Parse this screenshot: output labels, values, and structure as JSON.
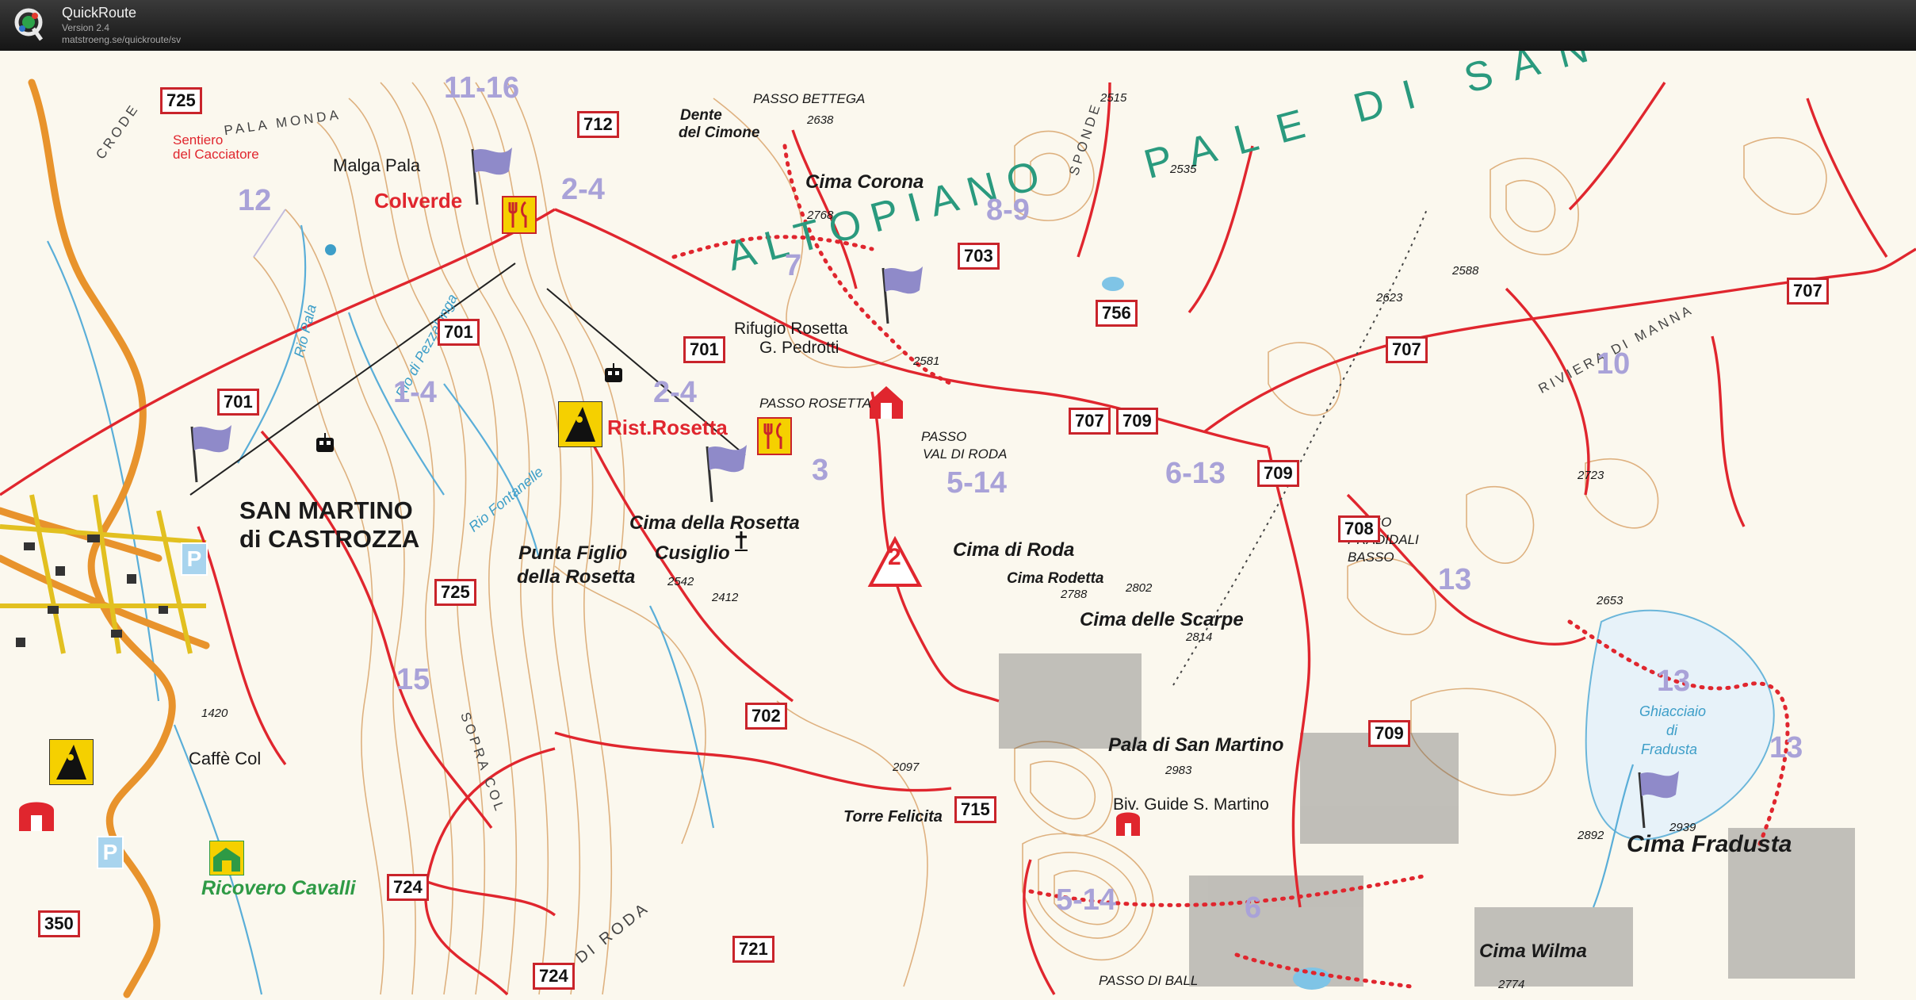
{
  "app": {
    "title": "QuickRoute",
    "version": "Version 2.4",
    "url": "matstroeng.se/quickroute/sv"
  },
  "map": {
    "place_names": [
      "SAN MARTINO",
      "di CASTROZZA",
      "Cima Corona",
      "Cima della Rosetta",
      "Punta Figlio",
      "della Rosetta",
      "Cusiglio",
      "Cima di Roda",
      "Cima Rodetta",
      "Cima delle Scarpe",
      "Pala di San Martino",
      "Biv. Guide S. Martino",
      "Torre Felicita",
      "Cima Fradusta",
      "Cima Wilma",
      "Malga Pala",
      "Caffè Col",
      "Dente",
      "del Cimone",
      "Rifugio Rosetta",
      "G. Pedrotti",
      "PASSO BETTEGA",
      "PASSO ROSETTA",
      "PASSO",
      "VAL DI RODA",
      "PASSO",
      "PRADIDALI",
      "BASSO",
      "PASSO DI BALL",
      "PALA MONDA",
      "CRODE",
      "SOPRA COL",
      "VAL DI RODA",
      "RIVIERA DI MANNA",
      "SPONDE",
      "Rio Pala",
      "Rio di Pezzalunga",
      "Rio Fontanelle",
      "Ghiacciaio",
      "di",
      "Fradusta",
      "Sentiero",
      "del Cacciatore"
    ],
    "poi_labels": [
      "Colverde",
      "Rist.Rosetta",
      "Ricovero Cavalli"
    ],
    "plateau_label": [
      "ALTOPIANO",
      "PALE DI SAN"
    ],
    "control_numbers": [
      "11-16",
      "12",
      "2-4",
      "8-9",
      "7",
      "1-4",
      "2-4",
      "3",
      "5-14",
      "6-13",
      "10",
      "13",
      "15",
      "13",
      "13",
      "5-14",
      "6",
      "2"
    ],
    "trail_numbers": [
      "725",
      "712",
      "703",
      "756",
      "701",
      "701",
      "707",
      "707",
      "707",
      "709",
      "709",
      "708",
      "725",
      "702",
      "709",
      "715",
      "724",
      "721",
      "350",
      "724"
    ],
    "elevations": [
      "2638",
      "2515",
      "2535",
      "2768",
      "2588",
      "2623",
      "2581",
      "2723",
      "2542",
      "2412",
      "2788",
      "2802",
      "2814",
      "2653",
      "1420",
      "2097",
      "2983",
      "2939",
      "2892",
      "2774"
    ],
    "colors": {
      "paper": "#fbf8ee",
      "trail": "#e0262e",
      "contour": "#d9a56c",
      "stream": "#5aaed8",
      "road": "#e8932c",
      "control_overlay": "#a9a2d8",
      "plateau_text": "#2a9a7e",
      "flag": "#8f8ac9",
      "poi_yellow": "#f5d000"
    },
    "icons": [
      "restaurant-icon",
      "restaurant-icon",
      "flag-icon",
      "flag-icon",
      "flag-icon",
      "flag-icon",
      "flag-icon",
      "cable-car-icon",
      "cable-car-icon",
      "cable-car-icon",
      "climbing-icon",
      "climbing-icon",
      "hut-icon",
      "hut-icon",
      "parking-icon",
      "parking-icon",
      "horse-icon",
      "cross-icon",
      "warning-triangle-icon"
    ]
  }
}
